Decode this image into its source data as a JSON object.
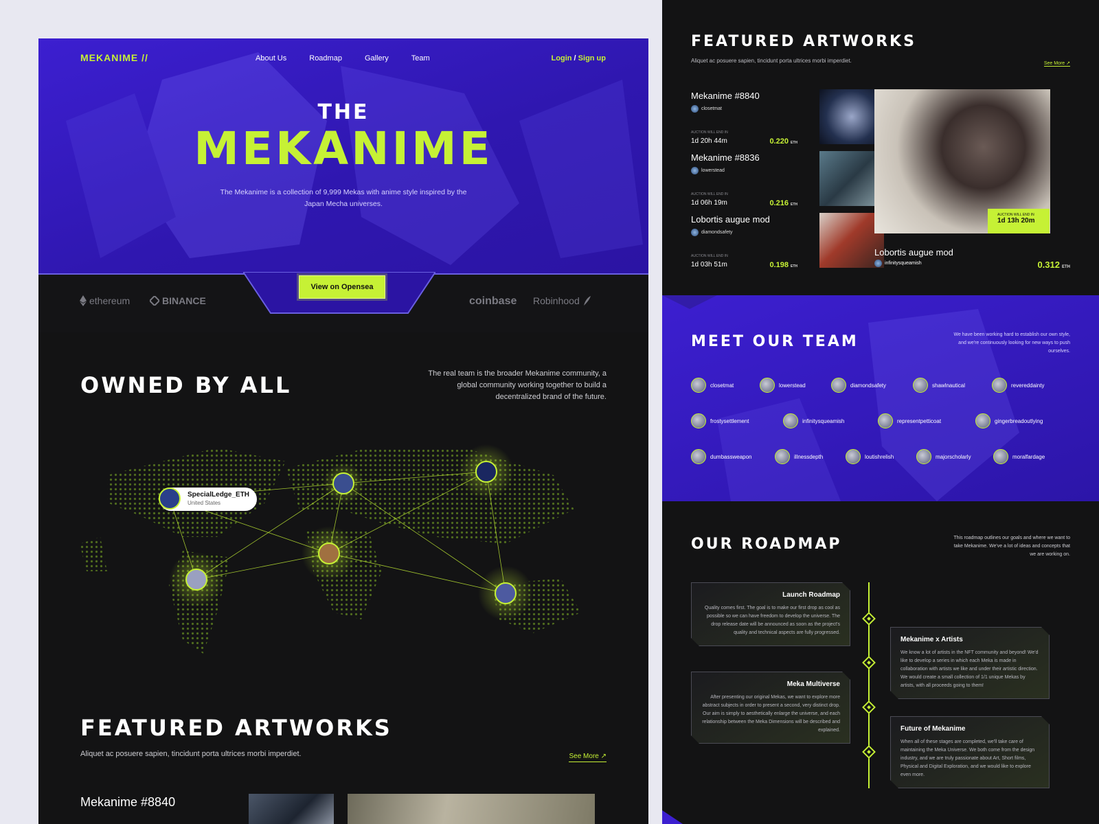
{
  "brand": {
    "logo": "MEKANIME //"
  },
  "nav": {
    "items": [
      "About Us",
      "Roadmap",
      "Gallery",
      "Team"
    ],
    "login": "Login",
    "separator": "/",
    "signup": "Sign up"
  },
  "hero": {
    "the": "THE",
    "title": "MEKANIME",
    "description": "The Mekanime is a collection of 9,999 Mekas with anime style inspired by the Japan Mecha universes.",
    "cta": "View on Opensea"
  },
  "partners": {
    "ethereum": "ethereum",
    "binance": "BINANCE",
    "coinbase": "coinbase",
    "robinhood": "Robinhood"
  },
  "owned": {
    "title": "OWNED BY ALL",
    "description": "The real team is the broader Mekanime community, a global community working together to build a decentralized brand of the future."
  },
  "map": {
    "tooltip_name": "SpecialLedge_ETH",
    "tooltip_country": "United States"
  },
  "featured": {
    "title": "FEATURED ARTWORKS",
    "subtitle": "Aliquet ac posuere sapien, tincidunt porta ultrices morbi imperdiet.",
    "see_more": "See More ↗",
    "first_item": "Mekanime #8840"
  },
  "artworks": [
    {
      "name": "Mekanime #8840",
      "owner": "closetmat",
      "auction_label": "AUCTION WILL END IN",
      "time": "1d 20h 44m",
      "price": "0.220",
      "currency": "ETH"
    },
    {
      "name": "Mekanime #8836",
      "owner": "lowerstead",
      "auction_label": "AUCTION WILL END IN",
      "time": "1d 06h 19m",
      "price": "0.216",
      "currency": "ETH"
    },
    {
      "name": "Lobortis augue mod",
      "owner": "diamondsafety",
      "auction_label": "AUCTION WILL END IN",
      "time": "1d 03h 51m",
      "price": "0.198",
      "currency": "ETH"
    }
  ],
  "big_artwork": {
    "name": "Lobortis augue mod",
    "owner": "infinitysqueamish",
    "auction_label": "AUCTION WILL END IN",
    "time": "1d 13h 20m",
    "price": "0.312",
    "currency": "ETH"
  },
  "team": {
    "title": "MEET OUR TEAM",
    "description": "We have been working hard to establish our own style, and we're continuously looking for new ways to push ourselves.",
    "members": [
      "closetmat",
      "lowerstead",
      "diamondsafety",
      "shawlnautical",
      "revereddainty",
      "frostysettlement",
      "infinitysqueamish",
      "representpetticoat",
      "gingerbreadoutlying",
      "dumbassweapon",
      "illnessdepth",
      "loutishrelish",
      "majorscholarly",
      "moralfardage"
    ]
  },
  "roadmap": {
    "title": "OUR ROADMAP",
    "description": "This roadmap outlines our goals and where we want to take Mekanime. We've a lot of ideas and concepts that we are working on.",
    "items": [
      {
        "title": "Launch Roadmap",
        "text": "Quality comes first. The goal is to make our first drop as cool as possible so we can have freedom to develop the universe. The drop release date will be announced as soon as the project's quality and technical aspects are fully progressed."
      },
      {
        "title": "Mekanime x Artists",
        "text": "We know a lot of artists in the NFT community and beyond! We'd like to develop a series in which each Meka is made in collaboration with artists we like and under their artistic direction. We would create a small collection of 1/1 unique Mekas by artists, with all proceeds going to them!"
      },
      {
        "title": "Meka Multiverse",
        "text": "After presenting our original Mekas, we want to explore more abstract subjects in order to present a second, very distinct drop. Our aim is simply to aesthetically enlarge the universe, and each relationship between the Meka Dimensions will be described and explained."
      },
      {
        "title": "Future of Mekanime",
        "text": "When all of these stages are completed, we'll take care of maintaining the Meka Universe. We both come from the design industry, and we are truly passionate about Art, Short films, Physical and Digital Exploration, and we would like to explore even more."
      }
    ]
  },
  "colors": {
    "accent": "#c6f135",
    "purple": "#3c1fd0",
    "dark": "#131314"
  }
}
